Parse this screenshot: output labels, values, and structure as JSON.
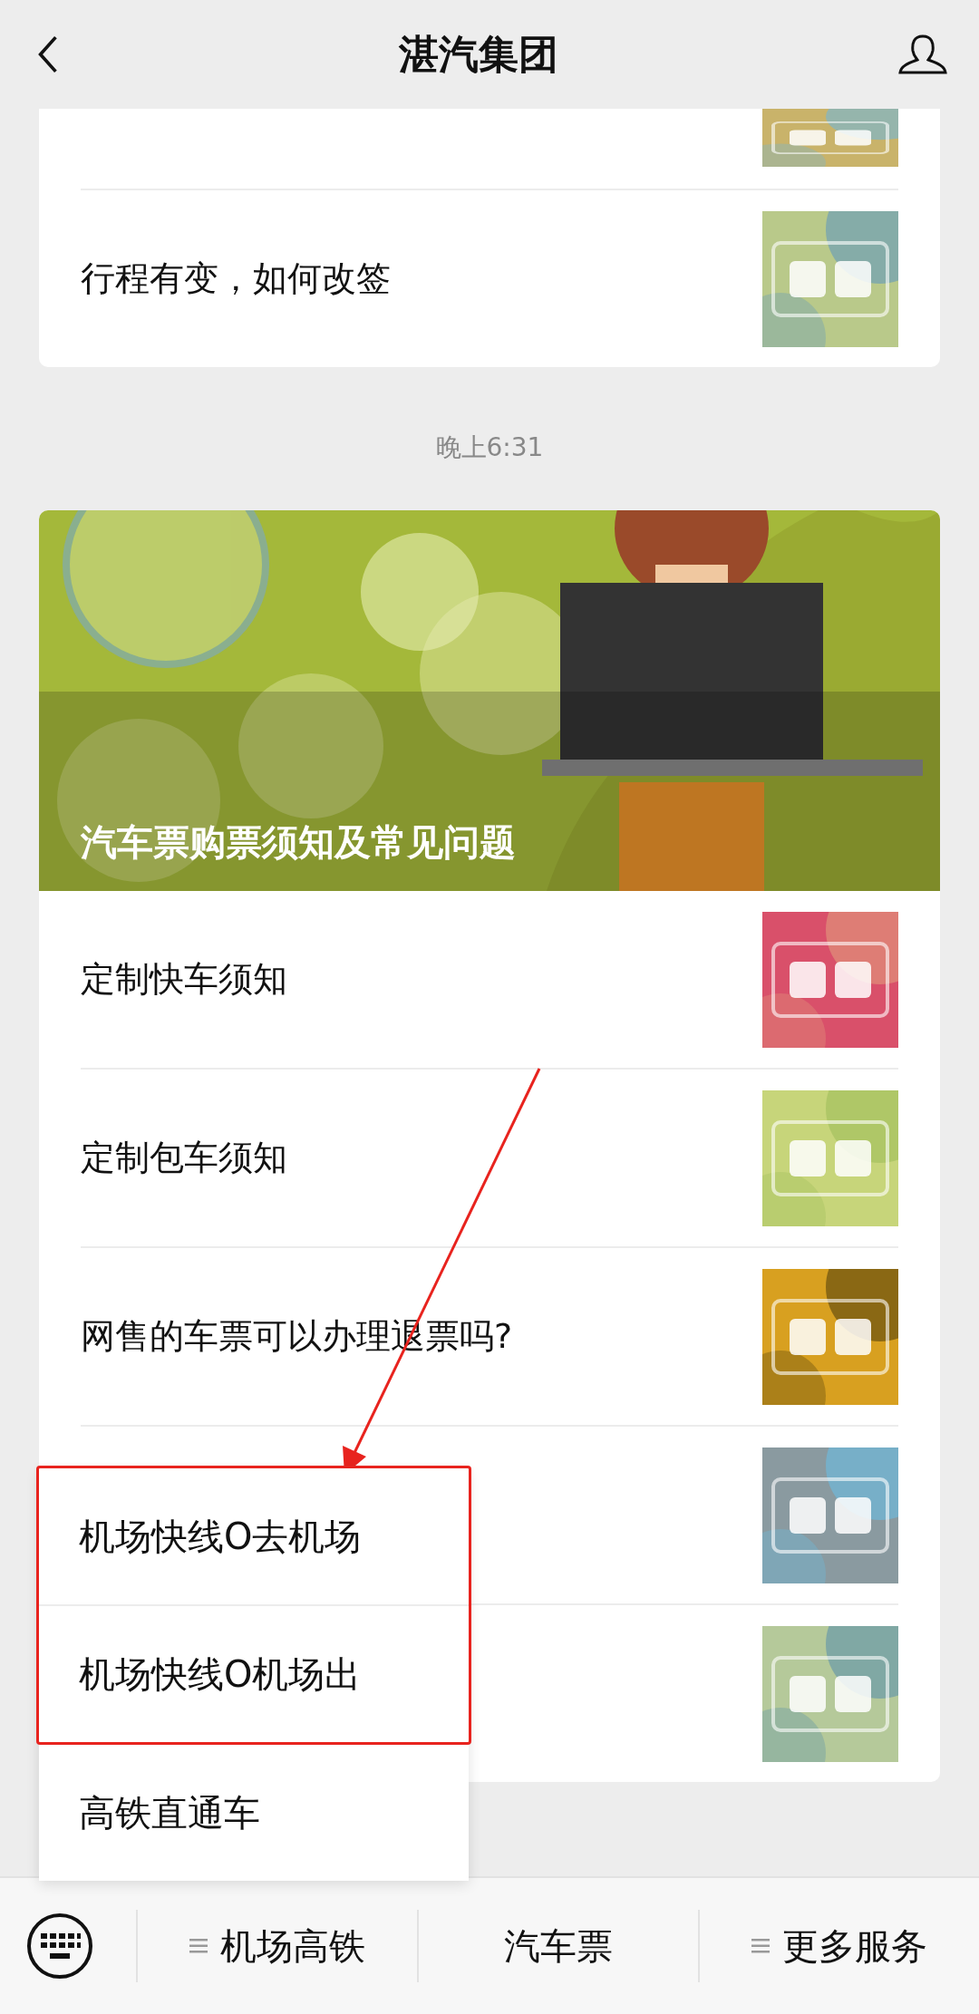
{
  "header": {
    "title": "湛汽集团"
  },
  "card_top": {
    "articles": [
      {
        "thumbnail": {
          "kind": "picture"
        }
      },
      {
        "title": "行程有变，如何改签",
        "thumbnail": {
          "kind": "picture"
        }
      }
    ]
  },
  "timestamp": "晚上6:31",
  "card_main": {
    "cover": {
      "kind": "picture",
      "title": "汽车票购票须知及常见问题"
    },
    "articles": [
      {
        "title": "定制快车须知",
        "thumbnail": {
          "kind": "picture"
        }
      },
      {
        "title": "定制包车须知",
        "thumbnail": {
          "kind": "picture"
        }
      },
      {
        "title": "网售的车票可以办理退票吗?",
        "thumbnail": {
          "kind": "picture"
        }
      },
      {
        "thumbnail": {
          "kind": "picture"
        }
      },
      {
        "thumbnail": {
          "kind": "picture"
        }
      }
    ]
  },
  "popup_menu": {
    "items": [
      {
        "label": "机场快线O去机场"
      },
      {
        "label": "机场快线O机场出"
      },
      {
        "label": "高铁直通车"
      }
    ]
  },
  "bottom_menu": {
    "items": [
      {
        "label": "机场高铁",
        "has_submenu": true
      },
      {
        "label": "汽车票",
        "has_submenu": false
      },
      {
        "label": "更多服务",
        "has_submenu": true
      }
    ]
  }
}
